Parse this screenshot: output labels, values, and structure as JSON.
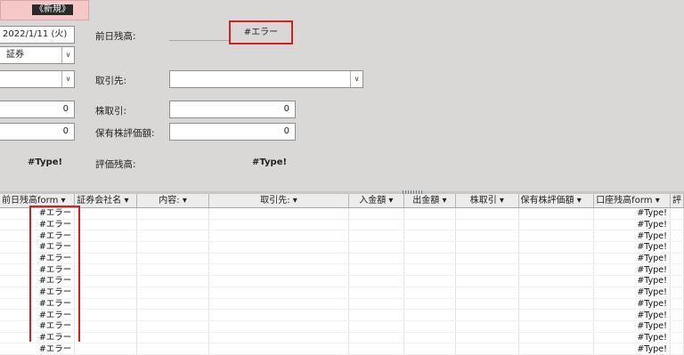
{
  "form": {
    "new_button": "《新規》",
    "date_value": "2022/1/11 (火)",
    "prev_balance_label": "前日残高:",
    "prev_balance_value": "#エラー",
    "company_value": "証券",
    "client_label": "取引先:",
    "client_value": "",
    "stock_trade_label": "株取引:",
    "stock_trade_value": "0",
    "left_value_1": "0",
    "left_value_2": "0",
    "holding_eval_label": "保有株評価額:",
    "holding_eval_value": "0",
    "left_type_value": "#Type!",
    "eval_balance_label": "評価残高:",
    "eval_balance_value": "#Type!"
  },
  "grid": {
    "columns": [
      "前日残高form",
      "証券会社名",
      "内容:",
      "取引先:",
      "入金額",
      "出金額",
      "株取引",
      "保有株評価額",
      "口座残高form",
      "評"
    ],
    "rows": [
      {
        "prev": "#エラー",
        "company": "",
        "content": "",
        "client": "",
        "deposit": "",
        "withdraw": "",
        "stock": "",
        "eval": "",
        "balance": "#Type!"
      },
      {
        "prev": "#エラー",
        "company": "",
        "content": "",
        "client": "",
        "deposit": "",
        "withdraw": "",
        "stock": "",
        "eval": "",
        "balance": "#Type!"
      },
      {
        "prev": "#エラー",
        "company": "",
        "content": "",
        "client": "",
        "deposit": "",
        "withdraw": "",
        "stock": "",
        "eval": "",
        "balance": "#Type!"
      },
      {
        "prev": "#エラー",
        "company": "",
        "content": "",
        "client": "",
        "deposit": "",
        "withdraw": "",
        "stock": "",
        "eval": "",
        "balance": "#Type!"
      },
      {
        "prev": "#エラー",
        "company": "",
        "content": "",
        "client": "",
        "deposit": "",
        "withdraw": "",
        "stock": "",
        "eval": "",
        "balance": "#Type!"
      },
      {
        "prev": "#エラー",
        "company": "",
        "content": "",
        "client": "",
        "deposit": "",
        "withdraw": "",
        "stock": "",
        "eval": "",
        "balance": "#Type!"
      },
      {
        "prev": "#エラー",
        "company": "",
        "content": "",
        "client": "",
        "deposit": "",
        "withdraw": "",
        "stock": "",
        "eval": "",
        "balance": "#Type!"
      },
      {
        "prev": "#エラー",
        "company": "",
        "content": "",
        "client": "",
        "deposit": "",
        "withdraw": "",
        "stock": "",
        "eval": "",
        "balance": "#Type!"
      },
      {
        "prev": "#エラー",
        "company": "",
        "content": "",
        "client": "",
        "deposit": "",
        "withdraw": "",
        "stock": "",
        "eval": "",
        "balance": "#Type!"
      },
      {
        "prev": "#エラー",
        "company": "",
        "content": "",
        "client": "",
        "deposit": "",
        "withdraw": "",
        "stock": "",
        "eval": "",
        "balance": "#Type!"
      },
      {
        "prev": "#エラー",
        "company": "",
        "content": "",
        "client": "",
        "deposit": "",
        "withdraw": "",
        "stock": "",
        "eval": "",
        "balance": "#Type!"
      },
      {
        "prev": "#エラー",
        "company": "",
        "content": "",
        "client": "",
        "deposit": "",
        "withdraw": "",
        "stock": "",
        "eval": "",
        "balance": "#Type!"
      },
      {
        "prev": "#エラー",
        "company": "",
        "content": "",
        "client": "",
        "deposit": "",
        "withdraw": "",
        "stock": "",
        "eval": "",
        "balance": "#Type!"
      }
    ]
  },
  "colors": {
    "form_bg": "#d9d8d7",
    "highlight_red": "#d61f1f",
    "new_button_bg": "#f6c7c7"
  },
  "icons": {
    "dropdown": "chevron-down-icon",
    "sort": "sort-arrow-icon"
  }
}
